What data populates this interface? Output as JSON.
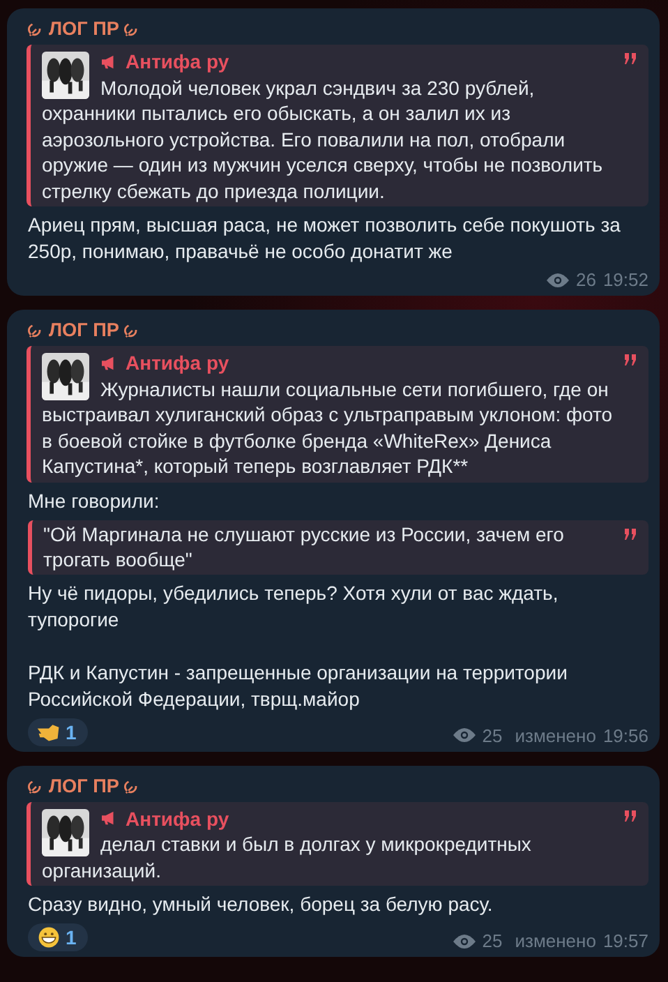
{
  "messages": [
    {
      "author": "ЛОГ ПР",
      "forward": {
        "channel": "Антифа ру",
        "text": "Молодой человек украл сэндвич за 230 рублей, охранники пытались его обыскать, а он залил их из аэрозольного устройства. Его повалили на пол, отобрали оружие — один из мужчин уселся сверху, чтобы не позволить стрелку сбежать до приезда полиции."
      },
      "body": [
        {
          "kind": "text",
          "text": "Ариец прям, высшая раса, не может позволить себе покушоть за 250р, понимаю, правачьё не особо донатит же"
        }
      ],
      "views": "26",
      "time": "19:52"
    },
    {
      "author": "ЛОГ ПР",
      "forward": {
        "channel": "Антифа ру",
        "text": "Журналисты нашли социальные сети погибшего, где он выстраивал хулиганский образ с ультраправым уклоном: фото в боевой стойке в футболке бренда «WhiteRex» Дениса Капустина*, который теперь возглавляет РДК**"
      },
      "body": [
        {
          "kind": "text",
          "text": "Мне говорили:"
        },
        {
          "kind": "quote",
          "text": "\"Ой Маргинала не слушают русские из России, зачем его трогать вообще\""
        },
        {
          "kind": "text",
          "text": "Ну чё пидоры, убедились теперь? Хотя хули от вас ждать, тупорогие"
        },
        {
          "kind": "text",
          "text": "РДК и Капустин - запрещенные организации на территории Российской Федерации, тврщ.майор"
        }
      ],
      "reactions": [
        {
          "kind": "pointing",
          "count": "1"
        }
      ],
      "views": "25",
      "edited": "изменено",
      "time": "19:56"
    },
    {
      "author": "ЛОГ ПР",
      "forward": {
        "channel": "Антифа ру",
        "text": "делал ставки и был в долгах у микрокредитных организаций."
      },
      "body": [
        {
          "kind": "text",
          "text": "Сразу видно, умный человек, борец за белую расу."
        }
      ],
      "reactions": [
        {
          "kind": "grin",
          "count": "1"
        }
      ],
      "views": "25",
      "edited": "изменено",
      "time": "19:57"
    }
  ]
}
